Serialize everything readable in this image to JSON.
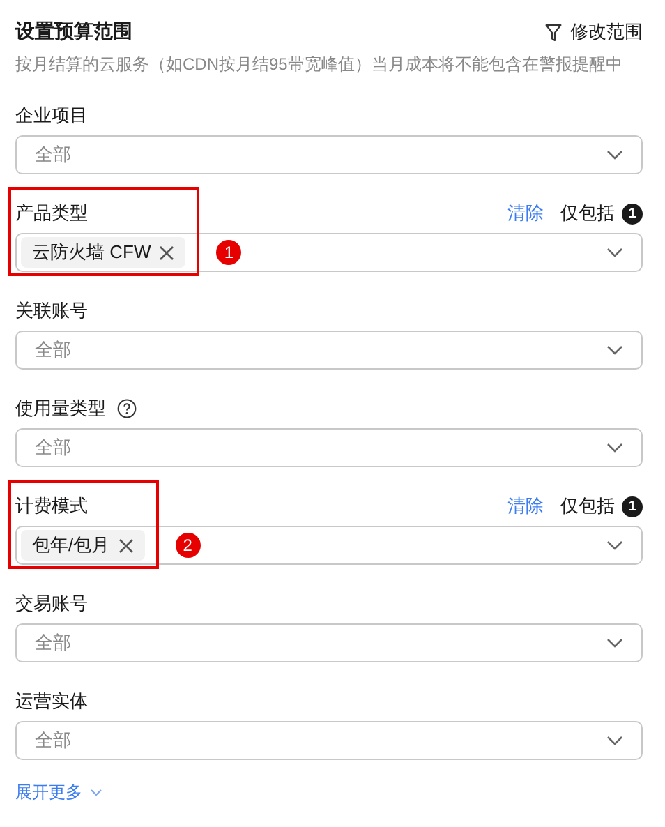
{
  "header": {
    "title": "设置预算范围",
    "edit_button": "修改范围",
    "description": "按月结算的云服务（如CDN按月结95带宽峰值）当月成本将不能包含在警报提醒中"
  },
  "filters": [
    {
      "kind": "select",
      "label": "企业项目",
      "help": false,
      "value": "全部"
    },
    {
      "kind": "tags",
      "label": "产品类型",
      "help": false,
      "clear": "清除",
      "include": "仅包括",
      "include_count": "1",
      "tags": [
        "云防火墙 CFW"
      ],
      "annotation": "1"
    },
    {
      "kind": "select",
      "label": "关联账号",
      "help": false,
      "value": "全部"
    },
    {
      "kind": "select",
      "label": "使用量类型",
      "help": true,
      "value": "全部"
    },
    {
      "kind": "tags",
      "label": "计费模式",
      "help": false,
      "clear": "清除",
      "include": "仅包括",
      "include_count": "1",
      "tags": [
        "包年/包月"
      ],
      "annotation": "2"
    },
    {
      "kind": "select",
      "label": "交易账号",
      "help": false,
      "value": "全部"
    },
    {
      "kind": "select",
      "label": "运营实体",
      "help": false,
      "value": "全部"
    }
  ],
  "expand_link": "展开更多"
}
